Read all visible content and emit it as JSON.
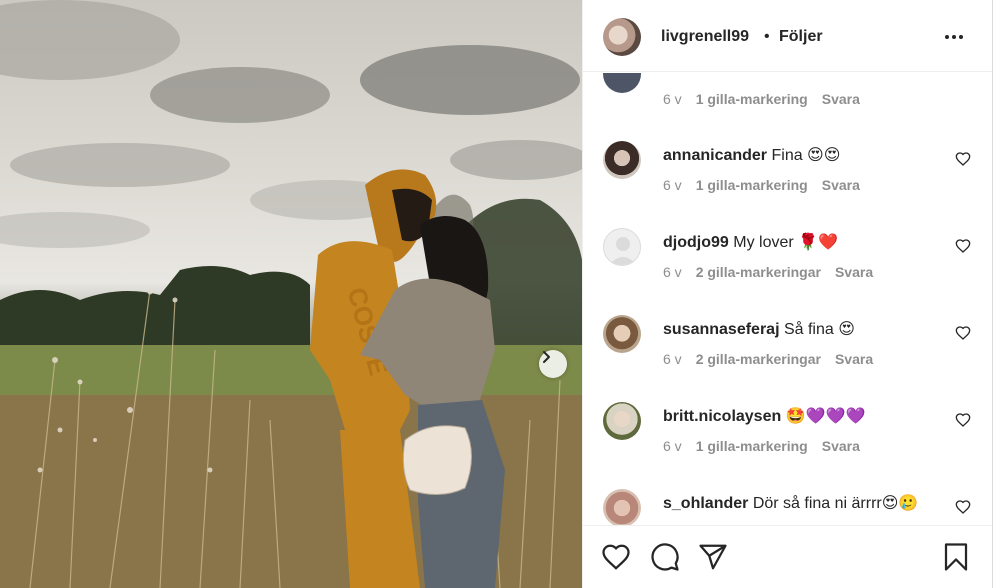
{
  "post": {
    "username": "livgrenell99",
    "separator": "•",
    "follow_label": "Följer"
  },
  "comments": [
    {
      "username": "",
      "text": "",
      "time": "6 v",
      "likes": "1 gilla-markering",
      "reply": "Svara",
      "partial": true
    },
    {
      "username": "annanicander",
      "text": "Fina 😍😍",
      "time": "6 v",
      "likes": "1 gilla-markering",
      "reply": "Svara"
    },
    {
      "username": "djodjo99",
      "text": "My lover 🌹❤️",
      "time": "6 v",
      "likes": "2 gilla-markeringar",
      "reply": "Svara"
    },
    {
      "username": "susannaseferaj",
      "text": "Så fina 😍",
      "time": "6 v",
      "likes": "2 gilla-markeringar",
      "reply": "Svara"
    },
    {
      "username": "britt.nicolaysen",
      "text": "🤩💜💜💜",
      "time": "6 v",
      "likes": "1 gilla-markering",
      "reply": "Svara"
    },
    {
      "username": "s_ohlander",
      "text": "Dör så fina ni ärrrr😍🥲",
      "time": "",
      "likes": "",
      "reply": "",
      "partial": true
    }
  ],
  "icons": {
    "more": "more-options-icon",
    "next": "chevron-right-icon",
    "like": "heart-icon",
    "comment": "comment-icon",
    "share": "send-icon",
    "save": "bookmark-icon"
  },
  "colors": {
    "text": "#262626",
    "secondary": "#8e8e8e",
    "border": "#efefef"
  }
}
